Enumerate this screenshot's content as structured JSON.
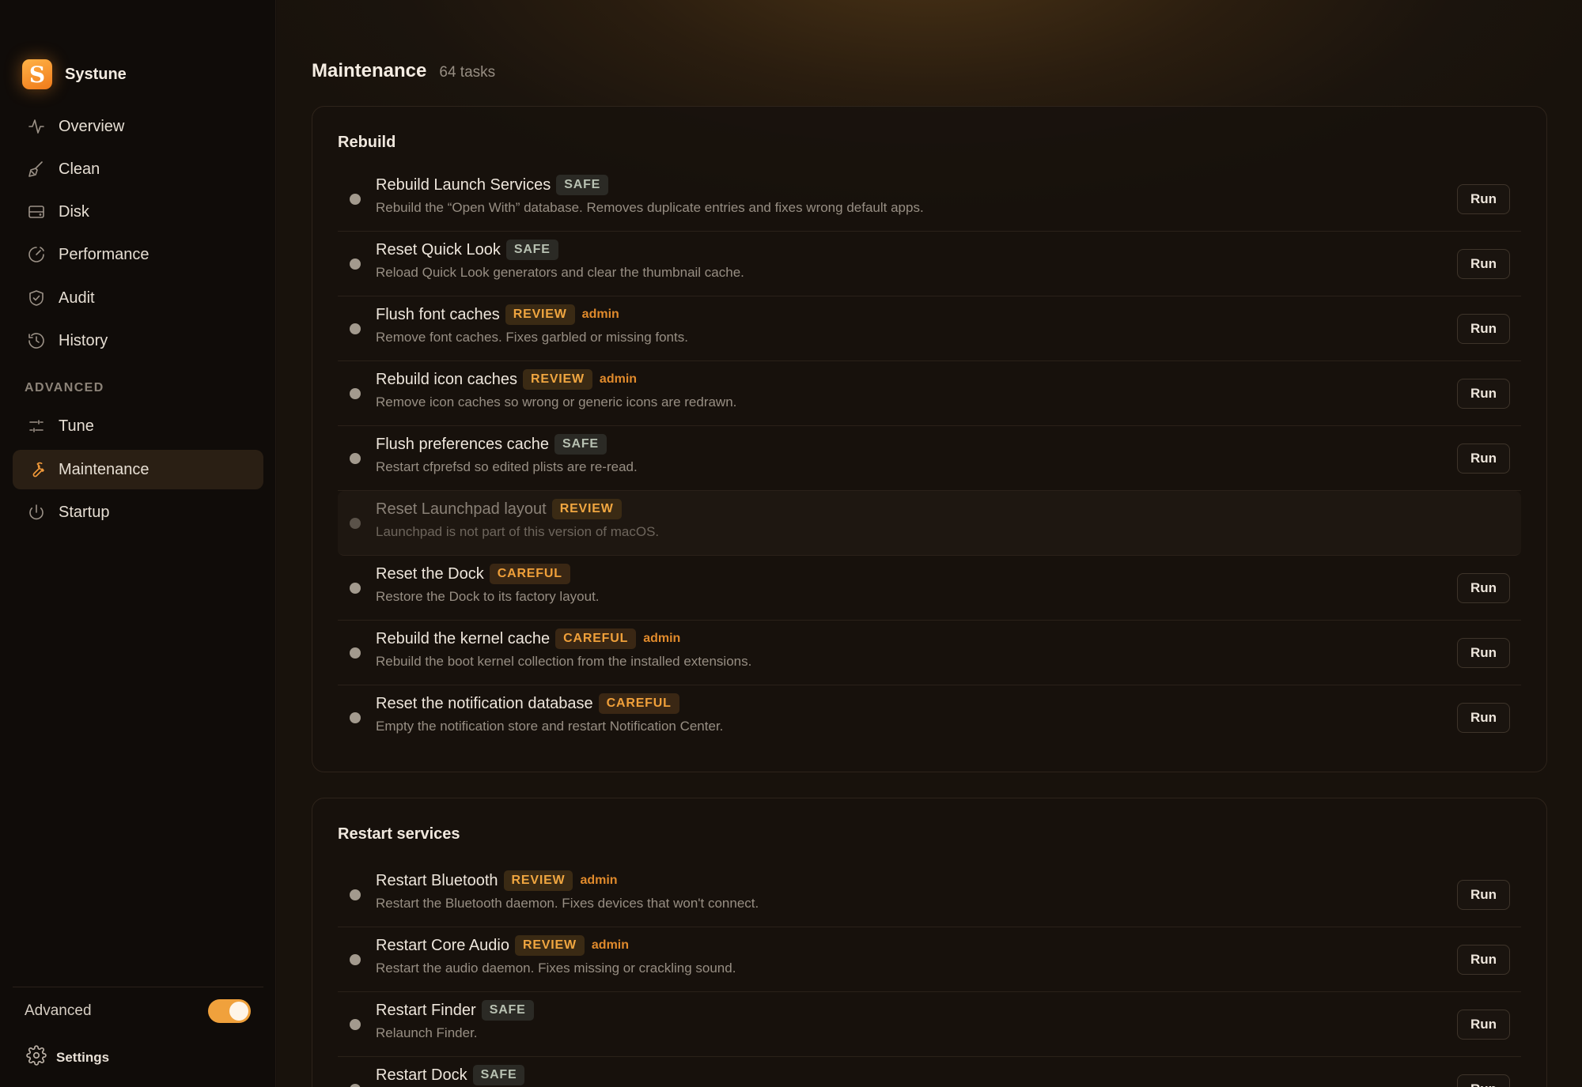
{
  "app": {
    "name": "Systune",
    "logo_letter": "S"
  },
  "nav": [
    {
      "label": "Overview",
      "icon": "activity-icon",
      "name": "sidebar-item-overview"
    },
    {
      "label": "Clean",
      "icon": "broom-icon",
      "name": "sidebar-item-clean"
    },
    {
      "label": "Disk",
      "icon": "disk-icon",
      "name": "sidebar-item-disk"
    },
    {
      "label": "Performance",
      "icon": "gauge-icon",
      "name": "sidebar-item-performance"
    },
    {
      "label": "Audit",
      "icon": "shield-check-icon",
      "name": "sidebar-item-audit"
    },
    {
      "label": "History",
      "icon": "history-icon",
      "name": "sidebar-item-history"
    }
  ],
  "advanced_section": {
    "label": "ADVANCED",
    "items": [
      {
        "label": "Tune",
        "icon": "sliders-icon",
        "name": "sidebar-item-tune"
      },
      {
        "label": "Maintenance",
        "icon": "wrench-icon",
        "name": "sidebar-item-maintenance",
        "active": true
      },
      {
        "label": "Startup",
        "icon": "power-icon",
        "name": "sidebar-item-startup"
      }
    ]
  },
  "footer": {
    "advanced_label": "Advanced",
    "advanced_on": true,
    "settings_label": "Settings"
  },
  "page": {
    "title": "Maintenance",
    "count": "64 tasks"
  },
  "run_label": "Run",
  "admin_label": "admin",
  "colors": {
    "accent": "#f0a13c",
    "background": "#15100b"
  },
  "sections": [
    {
      "title": "Rebuild",
      "tasks": [
        {
          "title": "Rebuild Launch Services",
          "badge": "SAFE",
          "admin": false,
          "desc": "Rebuild the “Open With” database. Removes duplicate entries and fixes wrong default apps."
        },
        {
          "title": "Reset Quick Look",
          "badge": "SAFE",
          "admin": false,
          "desc": "Reload Quick Look generators and clear the thumbnail cache."
        },
        {
          "title": "Flush font caches",
          "badge": "REVIEW",
          "admin": true,
          "desc": "Remove font caches. Fixes garbled or missing fonts."
        },
        {
          "title": "Rebuild icon caches",
          "badge": "REVIEW",
          "admin": true,
          "desc": "Remove icon caches so wrong or generic icons are redrawn."
        },
        {
          "title": "Flush preferences cache",
          "badge": "SAFE",
          "admin": false,
          "desc": "Restart cfprefsd so edited plists are re-read."
        },
        {
          "title": "Reset Launchpad layout",
          "badge": "REVIEW",
          "admin": false,
          "disabled": true,
          "desc": "Launchpad is not part of this version of macOS."
        },
        {
          "title": "Reset the Dock",
          "badge": "CAREFUL",
          "admin": false,
          "desc": "Restore the Dock to its factory layout."
        },
        {
          "title": "Rebuild the kernel cache",
          "badge": "CAREFUL",
          "admin": true,
          "desc": "Rebuild the boot kernel collection from the installed extensions."
        },
        {
          "title": "Reset the notification database",
          "badge": "CAREFUL",
          "admin": false,
          "desc": "Empty the notification store and restart Notification Center."
        }
      ]
    },
    {
      "title": "Restart services",
      "tasks": [
        {
          "title": "Restart Bluetooth",
          "badge": "REVIEW",
          "admin": true,
          "desc": "Restart the Bluetooth daemon. Fixes devices that won't connect."
        },
        {
          "title": "Restart Core Audio",
          "badge": "REVIEW",
          "admin": true,
          "desc": "Restart the audio daemon. Fixes missing or crackling sound."
        },
        {
          "title": "Restart Finder",
          "badge": "SAFE",
          "admin": false,
          "desc": "Relaunch Finder."
        },
        {
          "title": "Restart Dock",
          "badge": "SAFE",
          "admin": false,
          "desc": ""
        }
      ]
    }
  ]
}
